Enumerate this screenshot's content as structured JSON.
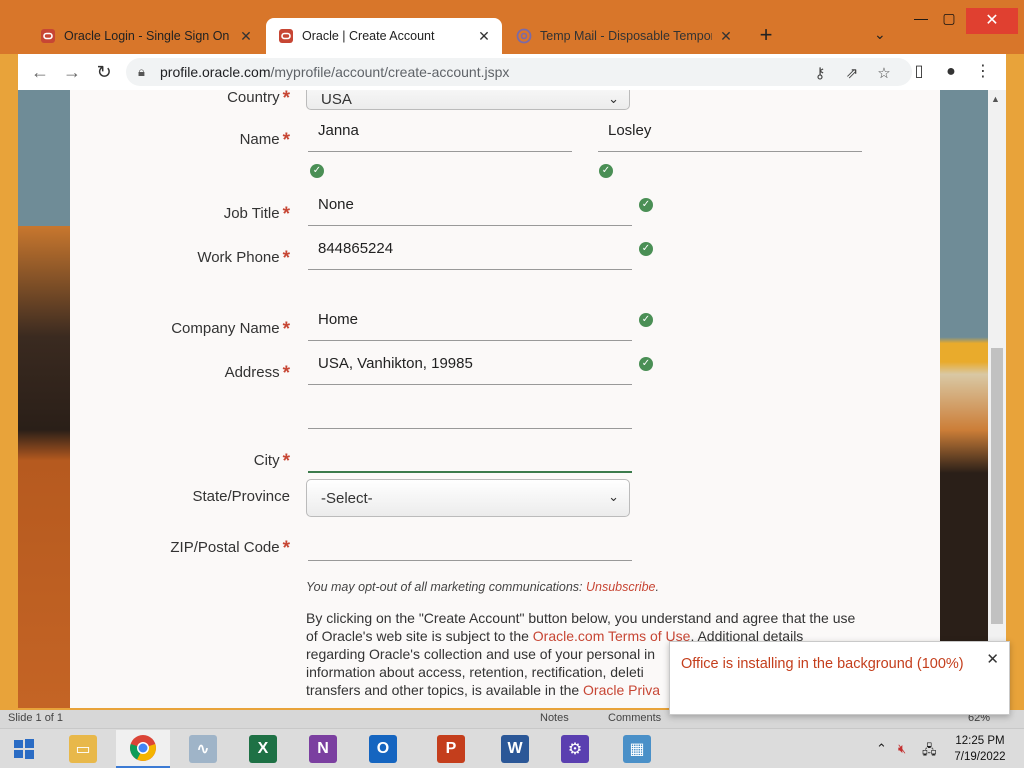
{
  "browser": {
    "tabs": [
      {
        "title": "Oracle Login - Single Sign On",
        "icon": "oracle-icon",
        "active": false
      },
      {
        "title": "Oracle | Create Account",
        "icon": "oracle-icon",
        "active": true
      },
      {
        "title": "Temp Mail - Disposable Tempora",
        "icon": "tempmail-icon",
        "active": false
      }
    ],
    "url_host": "profile.oracle.com",
    "url_path": "/myprofile/account/create-account.jspx"
  },
  "form": {
    "country_label": "Country",
    "country_value": "USA",
    "name_label": "Name",
    "first_name": "Janna",
    "last_name": "Losley",
    "job_title_label": "Job Title",
    "job_title": "None",
    "work_phone_label": "Work Phone",
    "work_phone": "844865224",
    "company_label": "Company Name",
    "company": "Home",
    "address_label": "Address",
    "address": "USA, Vanhikton, 19985",
    "address2": "",
    "city_label": "City",
    "city": "",
    "state_label": "State/Province",
    "state_value": "-Select-",
    "zip_label": "ZIP/Postal Code",
    "zip": ""
  },
  "optout": {
    "text": "You may opt-out of all marketing communications: ",
    "link": "Unsubscribe",
    "suffix": "."
  },
  "legal": {
    "p1": "By clicking on the \"Create Account\" button below, you understand and agree that the use of Oracle's web site is subject to the ",
    "link1": "Oracle.com Terms of Use",
    "p2": ". Additional details regarding Oracle's collection and use of your personal in",
    "p3": "information about access, retention, rectification, deleti",
    "p4": "transfers and other topics, is available in the ",
    "link2": "Oracle Priva"
  },
  "toast": {
    "message": "Office is installing in the background (100%)"
  },
  "ppt_status": {
    "slide": "Slide 1 of 1",
    "notes": "Notes",
    "comments": "Comments",
    "zoom": "62%"
  },
  "taskbar": {
    "time": "12:25 PM",
    "date": "7/19/2022",
    "apps": [
      "start",
      "file-explorer",
      "chrome",
      "task-manager",
      "excel",
      "onenote",
      "outlook",
      "powerpoint",
      "word",
      "settings",
      "control-panel"
    ]
  },
  "colors": {
    "accent": "#c74634",
    "valid": "#4a8f55",
    "tabbar": "#d8762a"
  }
}
